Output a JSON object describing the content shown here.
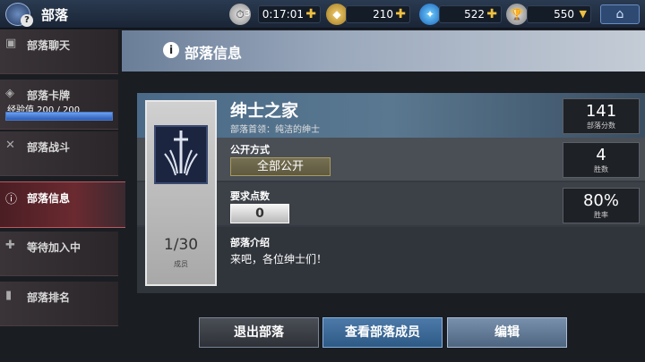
{
  "topbar": {
    "title": "部落",
    "help_badge": "?",
    "timer_count": "3",
    "timer_value": "0:17:01",
    "gold_value": "210",
    "gem_value": "522",
    "trophy_value": "550",
    "plus_glyph": "✚",
    "caret_glyph": "▼",
    "home_icon": "⌂"
  },
  "sidebar": {
    "items": [
      {
        "label": "部落聊天",
        "icon": "chat-icon"
      },
      {
        "label": "部落卡牌",
        "icon": "cards-icon"
      },
      {
        "label": "部落战斗",
        "icon": "swords-icon"
      },
      {
        "label": "部落信息",
        "icon": "info-icon"
      },
      {
        "label": "等待加入中",
        "icon": "plus-icon"
      },
      {
        "label": "部落排名",
        "icon": "ranking-icon"
      }
    ],
    "xp_label": "经验值 200 / 200",
    "xp_fraction": 1.0
  },
  "header": {
    "icon_glyph": "i",
    "title": "部落信息"
  },
  "clan": {
    "name": "绅士之家",
    "leader": "部落首领：纯洁的绅士",
    "members_count": "1/30",
    "members_label": "成员",
    "join_mode_label": "公开方式",
    "join_mode_value": "全部公开",
    "required_points_label": "要求点数",
    "required_points_value": "0",
    "intro_label": "部落介绍",
    "intro_text": "来吧，各位绅士们！"
  },
  "stats": [
    {
      "value": "141",
      "label": "部落分数"
    },
    {
      "value": "4",
      "label": "胜数"
    },
    {
      "value": "80%",
      "label": "胜率"
    }
  ],
  "buttons": {
    "leave": "退出部落",
    "members": "查看部落成员",
    "edit": "编辑"
  }
}
